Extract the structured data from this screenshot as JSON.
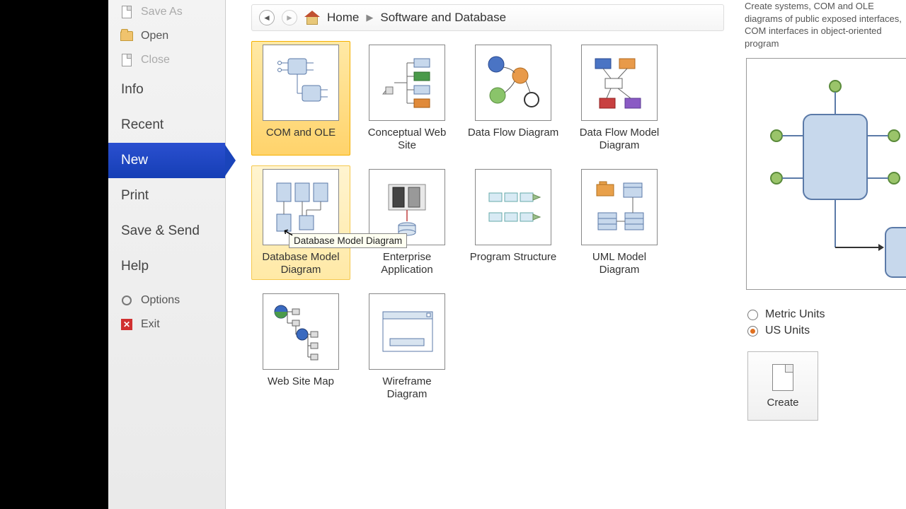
{
  "sidebar": {
    "items": [
      {
        "label": "Save As",
        "icon": "doc",
        "disabled": true
      },
      {
        "label": "Open",
        "icon": "folder"
      },
      {
        "label": "Close",
        "icon": "doc",
        "disabled": true
      }
    ],
    "sections": [
      {
        "label": "Info"
      },
      {
        "label": "Recent"
      },
      {
        "label": "New",
        "selected": true
      },
      {
        "label": "Print"
      },
      {
        "label": "Save & Send"
      },
      {
        "label": "Help"
      }
    ],
    "footer": [
      {
        "label": "Options",
        "icon": "cog"
      },
      {
        "label": "Exit",
        "icon": "exit"
      }
    ]
  },
  "breadcrumb": {
    "home": "Home",
    "path": "Software and Database"
  },
  "templates": [
    {
      "label": "COM and OLE",
      "state": "selected"
    },
    {
      "label": "Conceptual Web Site"
    },
    {
      "label": "Data Flow Diagram"
    },
    {
      "label": "Data Flow Model Diagram"
    },
    {
      "label": "Database Model Diagram",
      "state": "hover",
      "tooltip": "Database Model Diagram"
    },
    {
      "label": "Enterprise Application"
    },
    {
      "label": "Program Structure"
    },
    {
      "label": "UML Model Diagram"
    },
    {
      "label": "Web Site Map"
    },
    {
      "label": "Wireframe Diagram"
    }
  ],
  "rightpane": {
    "description": "Create systems, COM and OLE diagrams of public exposed interfaces, COM interfaces in object-oriented program",
    "units": {
      "metric": "Metric Units",
      "us": "US Units",
      "selected": "us"
    },
    "create": "Create"
  }
}
